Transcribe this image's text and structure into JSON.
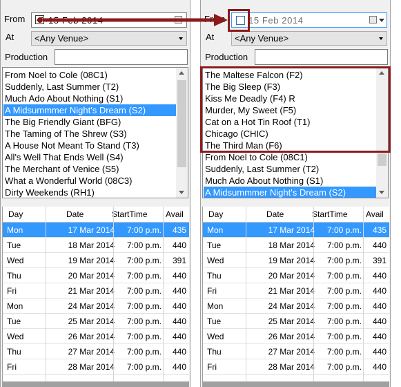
{
  "colors": {
    "accent": "#3399ff",
    "annotation": "#8b1a1a"
  },
  "left": {
    "from_label": "From",
    "from_checked": true,
    "from_date": "15  Feb  2014",
    "at_label": "At",
    "venue": "<Any Venue>",
    "production_label": "Production",
    "production_value": "",
    "list": [
      "From Noel to Cole (08C1)",
      "Suddenly, Last Summer (T2)",
      "Much Ado About Nothing (S1)",
      "A Midsummmer Night's Dream (S2)",
      "The Big Friendly Giant (BFG)",
      "The Taming of The Shrew (S3)",
      "A House Not Meant To Stand (T3)",
      "All's Well That Ends Well (S4)",
      "The Merchant of Venice (S5)",
      "What a Wonderful World (08C3)",
      "Dirty Weekends (RH1)"
    ],
    "selected_index": 3
  },
  "right": {
    "from_label": "From",
    "from_checked": false,
    "from_date": "15  Feb  2014",
    "at_label": "At",
    "venue": "<Any Venue>",
    "production_label": "Production",
    "production_value": "",
    "list": [
      "The Maltese Falcon (F2)",
      "The Big Sleep (F3)",
      "Kiss Me Deadly (F4) R",
      "Murder, My Sweet (F5)",
      "Cat on a Hot Tin Roof (T1)",
      "Chicago (CHIC)",
      "The Third Man (F6)",
      "From Noel to Cole (08C1)",
      "Suddenly, Last Summer (T2)",
      "Much Ado About Nothing (S1)",
      "A Midsummmer Night's Dream (S2)"
    ],
    "selected_index": 10
  },
  "grid": {
    "headers": [
      "Day",
      "Date",
      "StartTime",
      "Avail"
    ],
    "rows": [
      [
        "Mon",
        "17 Mar 2014",
        "7:00 p.m.",
        "435"
      ],
      [
        "Tue",
        "18 Mar 2014",
        "7:00 p.m.",
        "440"
      ],
      [
        "Wed",
        "19 Mar 2014",
        "7:00 p.m.",
        "391"
      ],
      [
        "Thu",
        "20 Mar 2014",
        "7:00 p.m.",
        "440"
      ],
      [
        "Fri",
        "21 Mar 2014",
        "7:00 p.m.",
        "440"
      ],
      [
        "Mon",
        "24 Mar 2014",
        "7:00 p.m.",
        "440"
      ],
      [
        "Tue",
        "25 Mar 2014",
        "7:00 p.m.",
        "440"
      ],
      [
        "Wed",
        "26 Mar 2014",
        "7:00 p.m.",
        "440"
      ],
      [
        "Thu",
        "27 Mar 2014",
        "7:00 p.m.",
        "440"
      ],
      [
        "Fri",
        "28 Mar 2014",
        "7:00 p.m.",
        "440"
      ]
    ],
    "selected_row": 0
  }
}
